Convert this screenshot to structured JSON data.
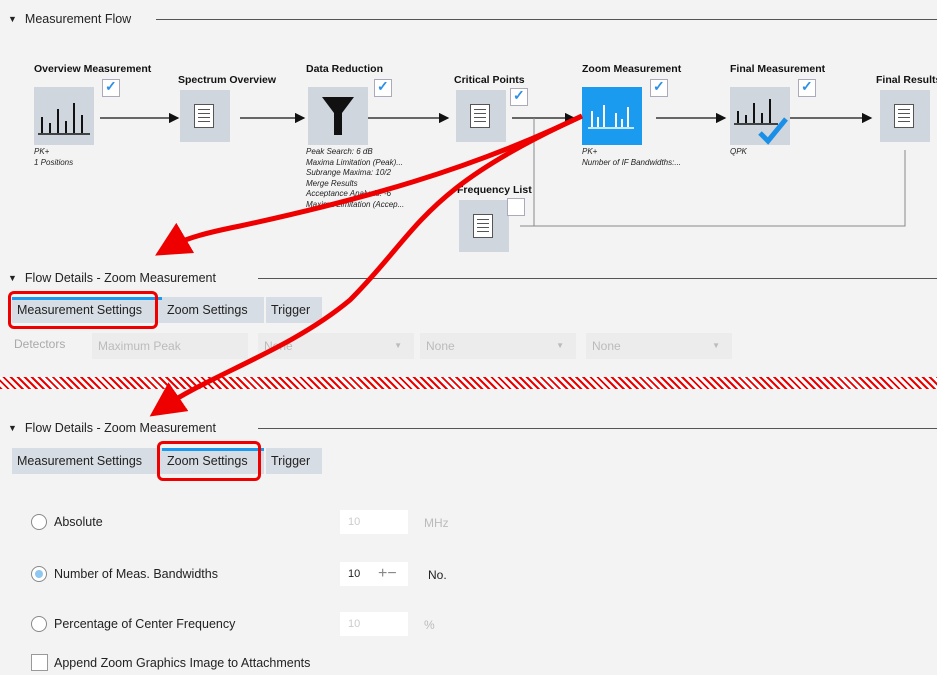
{
  "measurement_flow": {
    "heading": "Measurement Flow",
    "nodes": [
      {
        "title": "Overview Measurement",
        "desc": [
          "PK+",
          "1 Positions"
        ],
        "checked": true,
        "icon": "bar-chart-icon"
      },
      {
        "title": "Spectrum Overview",
        "desc": [],
        "icon": "document-icon"
      },
      {
        "title": "Data Reduction",
        "desc": [
          "Peak Search: 6 dB",
          "Maxima Limitation (Peak)...",
          "Subrange Maxima: 10/2",
          "Merge Results",
          "Acceptance Analysis: -6",
          "Maxima Limitation (Accep..."
        ],
        "checked": true,
        "icon": "filter-funnel-icon"
      },
      {
        "title": "Critical Points",
        "desc": [],
        "checked": true,
        "icon": "document-icon"
      },
      {
        "title": "Zoom Measurement",
        "desc": [
          "PK+",
          "Number of IF Bandwidths:..."
        ],
        "checked": true,
        "icon": "bar-chart-icon"
      },
      {
        "title": "Final Measurement",
        "desc": [
          "QPK"
        ],
        "checked": true,
        "icon": "bar-chart-check-icon"
      },
      {
        "title": "Final Results",
        "desc": [],
        "icon": "document-icon"
      },
      {
        "title": "Frequency List",
        "desc": [],
        "checked": false,
        "icon": "document-icon"
      }
    ]
  },
  "flow_details_1": {
    "heading": "Flow Details  -  Zoom Measurement",
    "tabs": [
      "Measurement Settings",
      "Zoom Settings",
      "Trigger"
    ],
    "detectors_label": "Detectors",
    "detectors": [
      "Maximum Peak",
      "None",
      "None",
      "None"
    ]
  },
  "flow_details_2": {
    "heading": "Flow Details  -  Zoom Measurement",
    "tabs": [
      "Measurement Settings",
      "Zoom Settings",
      "Trigger"
    ],
    "options": [
      {
        "label": "Absolute",
        "value": "10",
        "unit": "MHz",
        "selected": false
      },
      {
        "label": "Number of Meas. Bandwidths",
        "value": "10",
        "unit": "No.",
        "selected": true
      },
      {
        "label": "Percentage of Center Frequency",
        "value": "10",
        "unit": "%",
        "selected": false
      }
    ],
    "stepper_symbol": "+−",
    "append_label": "Append Zoom Graphics Image to Attachments"
  },
  "colors": {
    "accent": "#1a9bf0",
    "annotation_red": "#e00000"
  }
}
